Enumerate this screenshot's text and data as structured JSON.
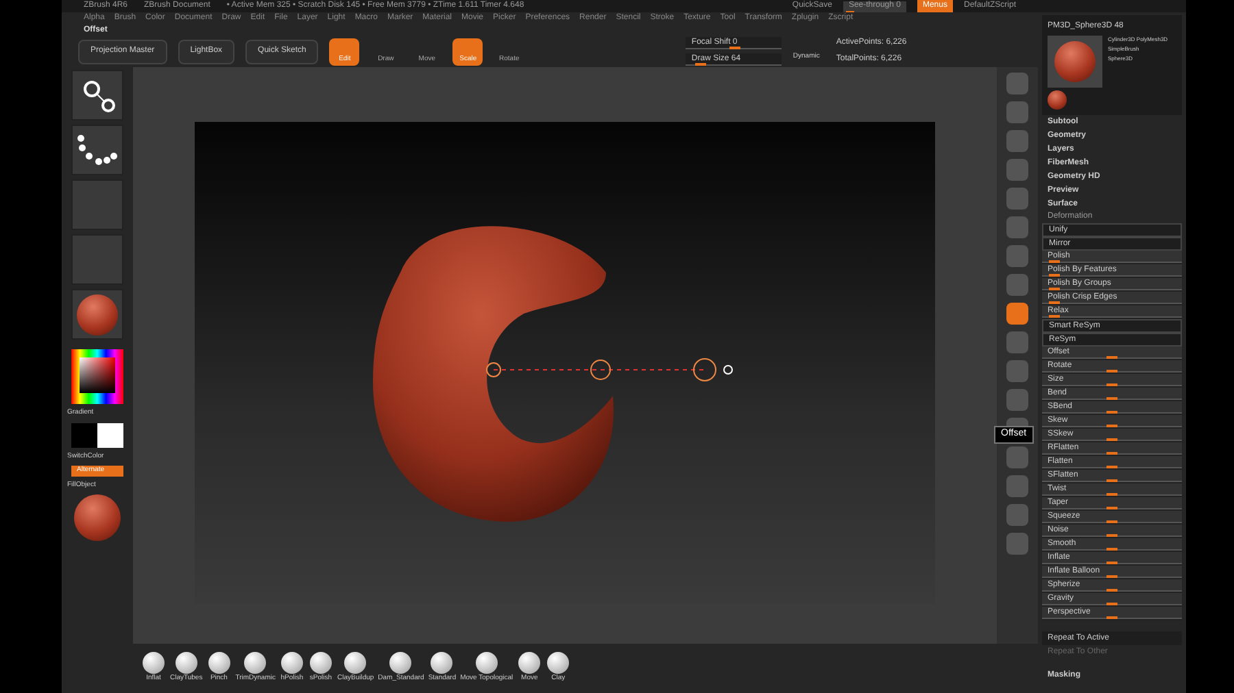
{
  "title_bar": {
    "app": "ZBrush 4R6",
    "document": "ZBrush Document",
    "stats": "• Active Mem 325 • Scratch Disk 145 • Free Mem 3779 • ZTime 1.611 Timer 4.648"
  },
  "menus": [
    "Alpha",
    "Brush",
    "Color",
    "Document",
    "Draw",
    "Edit",
    "File",
    "Layer",
    "Light",
    "Macro",
    "Marker",
    "Material",
    "Movie",
    "Picker",
    "Preferences",
    "Render",
    "Stencil",
    "Stroke",
    "Texture",
    "Tool",
    "Transform",
    "Zplugin",
    "Zscript"
  ],
  "top_right": {
    "quicksave": "QuickSave",
    "see_through": {
      "label": "See-through 0",
      "level": 0.05
    },
    "menus": {
      "label": "Menus",
      "on": true
    },
    "script": "DefaultZScript"
  },
  "palette_title": "Offset",
  "toolbar": [
    {
      "label": "Projection Master",
      "kind": "text",
      "selected": false
    },
    {
      "label": "LightBox",
      "kind": "text",
      "selected": false
    },
    {
      "label": "Quick Sketch",
      "kind": "text",
      "selected": false
    },
    {
      "label": "Edit",
      "kind": "icon",
      "selected": true
    },
    {
      "label": "Draw",
      "kind": "icon",
      "selected": false
    },
    {
      "label": "Move",
      "kind": "icon",
      "selected": false
    },
    {
      "label": "Scale",
      "kind": "icon",
      "selected": true
    },
    {
      "label": "Rotate",
      "kind": "icon",
      "selected": false
    }
  ],
  "draw_settings": [
    {
      "label": "Focal Shift 0",
      "level": 0.5
    },
    {
      "label": "Draw Size 64",
      "level": 0.1
    }
  ],
  "dynamic": "Dynamic",
  "points": [
    "ActivePoints: 6,226",
    "TotalPoints: 6,226"
  ],
  "left_shelf": {
    "tiles": [
      {
        "kind": "brush"
      },
      {
        "kind": "stroke"
      },
      {
        "kind": "alpha"
      },
      {
        "kind": "texture"
      },
      {
        "kind": "material"
      }
    ],
    "gradient": "Gradient",
    "switch_color": "SwitchColor",
    "alternate": {
      "label": "Alternate",
      "on": true
    },
    "fill_object": "FillObject"
  },
  "tool": {
    "name": "PM3D_Sphere3D 48",
    "thumbs": [
      "Cylinder3D PolyMesh3D",
      "SimpleBrush",
      "Sphere3D"
    ]
  },
  "subpalettes": [
    "Subtool",
    "Geometry",
    "Layers",
    "FiberMesh",
    "Geometry HD",
    "Preview",
    "Surface"
  ],
  "deformation": {
    "title": "Deformation",
    "rows": [
      {
        "label": "Unify",
        "kind": "button"
      },
      {
        "label": "Mirror",
        "kind": "button"
      },
      {
        "label": "Polish",
        "kind": "slider",
        "level": 0.05
      },
      {
        "label": "Polish By Features",
        "kind": "slider",
        "level": 0.05
      },
      {
        "label": "Polish By Groups",
        "kind": "slider",
        "level": 0.05
      },
      {
        "label": "Polish Crisp Edges",
        "kind": "slider",
        "level": 0.05
      },
      {
        "label": "Relax",
        "kind": "slider",
        "level": 0.05
      },
      {
        "label": "Smart ReSym",
        "kind": "button"
      },
      {
        "label": "ReSym",
        "kind": "button"
      },
      {
        "label": "Offset",
        "kind": "slider",
        "level": 0.5
      },
      {
        "label": "Rotate",
        "kind": "slider",
        "level": 0.5
      },
      {
        "label": "Size",
        "kind": "slider",
        "level": 0.5
      },
      {
        "label": "Bend",
        "kind": "slider",
        "level": 0.5
      },
      {
        "label": "SBend",
        "kind": "slider",
        "level": 0.5
      },
      {
        "label": "Skew",
        "kind": "slider",
        "level": 0.5
      },
      {
        "label": "SSkew",
        "kind": "slider",
        "level": 0.5
      },
      {
        "label": "RFlatten",
        "kind": "slider",
        "level": 0.5
      },
      {
        "label": "Flatten",
        "kind": "slider",
        "level": 0.5
      },
      {
        "label": "SFlatten",
        "kind": "slider",
        "level": 0.5
      },
      {
        "label": "Twist",
        "kind": "slider",
        "level": 0.5
      },
      {
        "label": "Taper",
        "kind": "slider",
        "level": 0.5
      },
      {
        "label": "Squeeze",
        "kind": "slider",
        "level": 0.5
      },
      {
        "label": "Noise",
        "kind": "slider",
        "level": 0.5
      },
      {
        "label": "Smooth",
        "kind": "slider",
        "level": 0.5
      },
      {
        "label": "Inflate",
        "kind": "slider",
        "level": 0.5
      },
      {
        "label": "Inflate Balloon",
        "kind": "slider",
        "level": 0.5
      },
      {
        "label": "Spherize",
        "kind": "slider",
        "level": 0.5
      },
      {
        "label": "Gravity",
        "kind": "slider",
        "level": 0.5
      },
      {
        "label": "Perspective",
        "kind": "slider",
        "level": 0.5
      }
    ],
    "repeat_active": "Repeat To Active",
    "repeat_other": "Repeat To Other"
  },
  "masking": "Masking",
  "tooltip": "Offset",
  "brushes": [
    "Inflat",
    "ClayTubes",
    "Pinch",
    "TrimDynamic",
    "hPolish",
    "sPolish",
    "ClayBuildup",
    "Dam_Standard",
    "Standard",
    "Move Topological",
    "Move",
    "Clay"
  ]
}
